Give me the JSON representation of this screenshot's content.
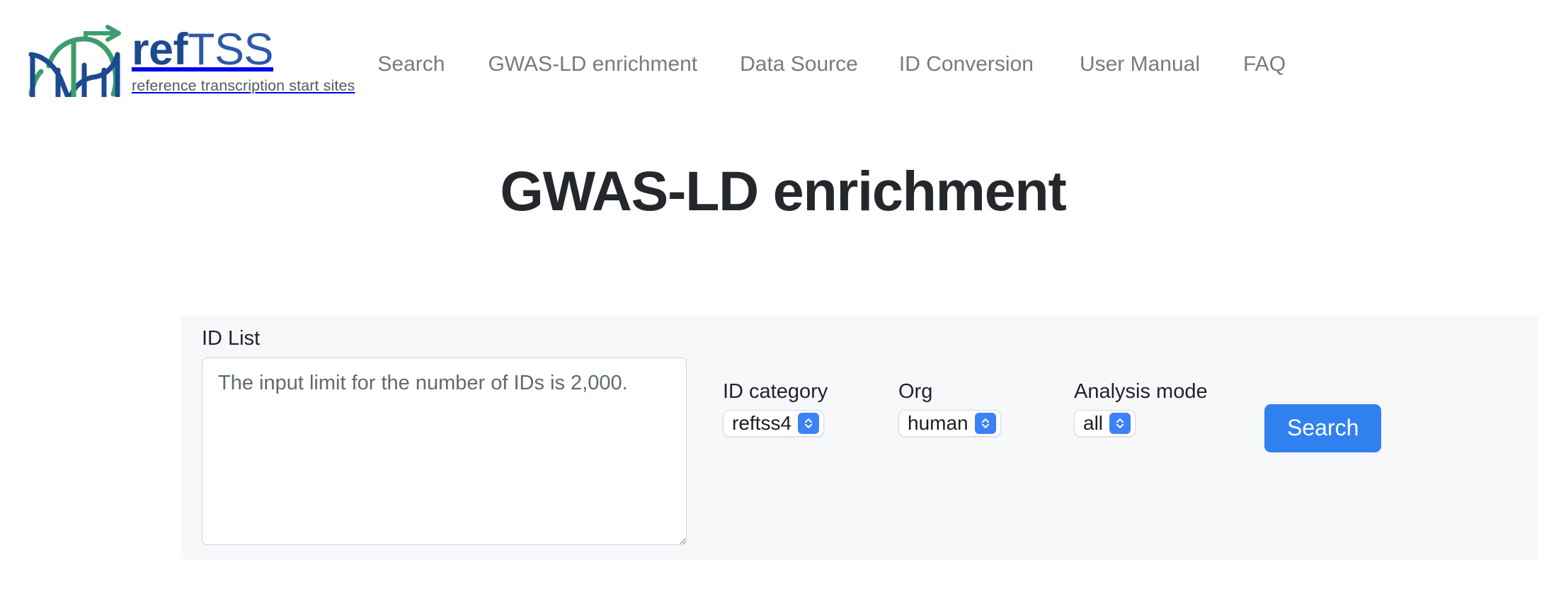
{
  "header": {
    "logo": {
      "mark_name": "dna-helix-arrow-logo",
      "wordmark_bold": "ref",
      "wordmark_light": "TSS",
      "tagline": "reference transcription start sites",
      "colors": {
        "blue": "#1b4a8f",
        "light_blue": "#2c5aa8",
        "green": "#3f9c6d"
      }
    },
    "nav": [
      {
        "label": "Search",
        "name": "nav-search"
      },
      {
        "label": "GWAS-LD enrichment",
        "name": "nav-gwas-ld-enrichment"
      },
      {
        "label": "Data Source",
        "name": "nav-data-source"
      },
      {
        "label": "ID Conversion",
        "name": "nav-id-conversion"
      },
      {
        "label": "User Manual",
        "name": "nav-user-manual"
      },
      {
        "label": "FAQ",
        "name": "nav-faq"
      }
    ]
  },
  "main": {
    "title": "GWAS-LD enrichment"
  },
  "form": {
    "id_list": {
      "label": "ID List",
      "placeholder": "The input limit for the number of IDs is 2,000.",
      "value": ""
    },
    "id_category": {
      "label": "ID category",
      "selected": "reftss4"
    },
    "org": {
      "label": "Org",
      "selected": "human"
    },
    "analysis_mode": {
      "label": "Analysis mode",
      "selected": "all"
    },
    "submit": {
      "label": "Search"
    }
  },
  "colors": {
    "accent_blue": "#3080f0",
    "stepper_blue": "#3b82f6",
    "panel_bg": "#f7f8fa",
    "nav_text": "#7a7a7a",
    "title_text": "#24282c"
  }
}
